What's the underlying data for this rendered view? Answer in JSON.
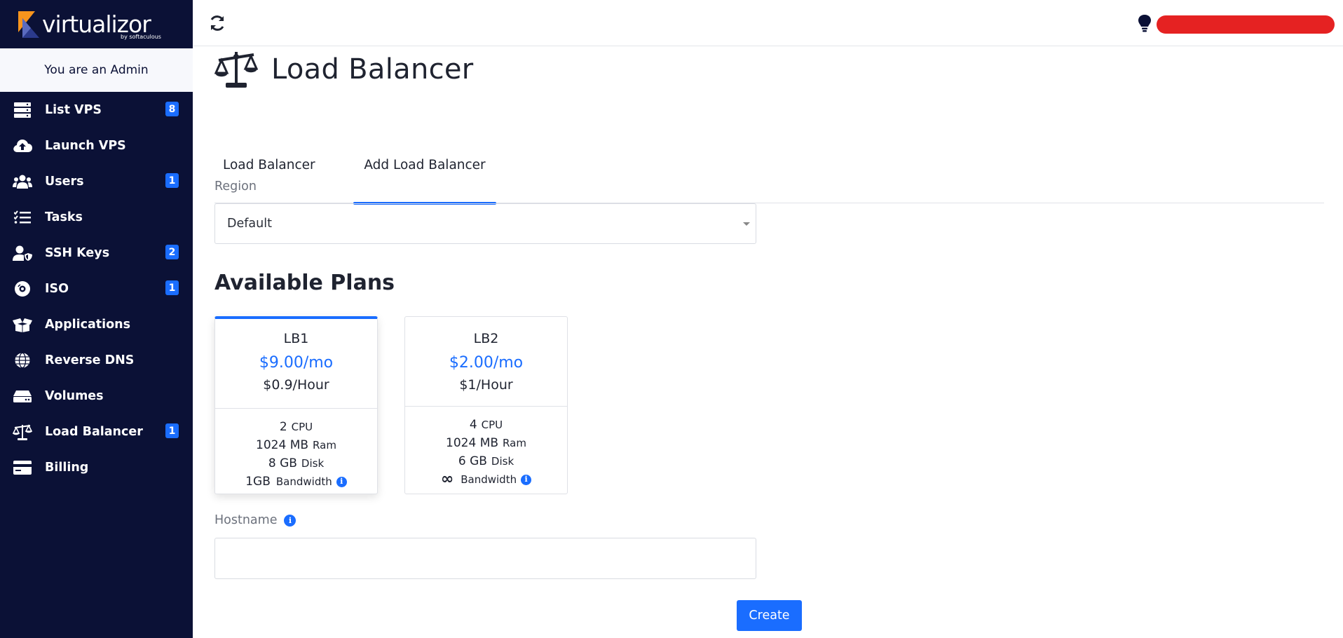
{
  "app": {
    "logo_text": "virtualizor",
    "logo_sub": "by softaculous",
    "role_text": "You are an Admin"
  },
  "sidebar": {
    "items": [
      {
        "label": "List VPS",
        "icon": "server-icon",
        "badge": "8"
      },
      {
        "label": "Launch VPS",
        "icon": "cloud-upload-icon",
        "badge": ""
      },
      {
        "label": "Users",
        "icon": "users-icon",
        "badge": "1"
      },
      {
        "label": "Tasks",
        "icon": "tasks-icon",
        "badge": ""
      },
      {
        "label": "SSH Keys",
        "icon": "user-shield-icon",
        "badge": "2"
      },
      {
        "label": "ISO",
        "icon": "disc-icon",
        "badge": "1"
      },
      {
        "label": "Applications",
        "icon": "box-open-icon",
        "badge": ""
      },
      {
        "label": "Reverse DNS",
        "icon": "globe-icon",
        "badge": ""
      },
      {
        "label": "Volumes",
        "icon": "hdd-icon",
        "badge": ""
      },
      {
        "label": "Load Balancer",
        "icon": "balance-scale-icon",
        "badge": "1"
      },
      {
        "label": "Billing",
        "icon": "credit-card-icon",
        "badge": ""
      }
    ]
  },
  "page": {
    "title": "Load Balancer",
    "tabs": [
      "Load Balancer",
      "Add Load Balancer"
    ],
    "active_tab": "Add Load Balancer",
    "region_label": "Region",
    "region_value": "Default",
    "plans_title": "Available Plans",
    "hostname_label": "Hostname",
    "hostname_value": "",
    "create_label": "Create"
  },
  "plans": [
    {
      "name": "LB1",
      "price": "$9.00/mo",
      "hourly": "$0.9/Hour",
      "cpu": "2",
      "cpu_unit": "CPU",
      "ram": "1024 MB",
      "ram_unit": "Ram",
      "disk": "8 GB",
      "disk_unit": "Disk",
      "bandwidth": "1GB",
      "bandwidth_unit": "Bandwidth",
      "selected": true
    },
    {
      "name": "LB2",
      "price": "$2.00/mo",
      "hourly": "$1/Hour",
      "cpu": "4",
      "cpu_unit": "CPU",
      "ram": "1024 MB",
      "ram_unit": "Ram",
      "disk": "6 GB",
      "disk_unit": "Disk",
      "bandwidth": "",
      "bandwidth_symbol": "infinity-icon",
      "bandwidth_unit": "Bandwidth",
      "selected": false
    }
  ],
  "colors": {
    "sidebar_bg": "#0b1136",
    "accent": "#1a6dff",
    "user_pill": "#e52222"
  }
}
